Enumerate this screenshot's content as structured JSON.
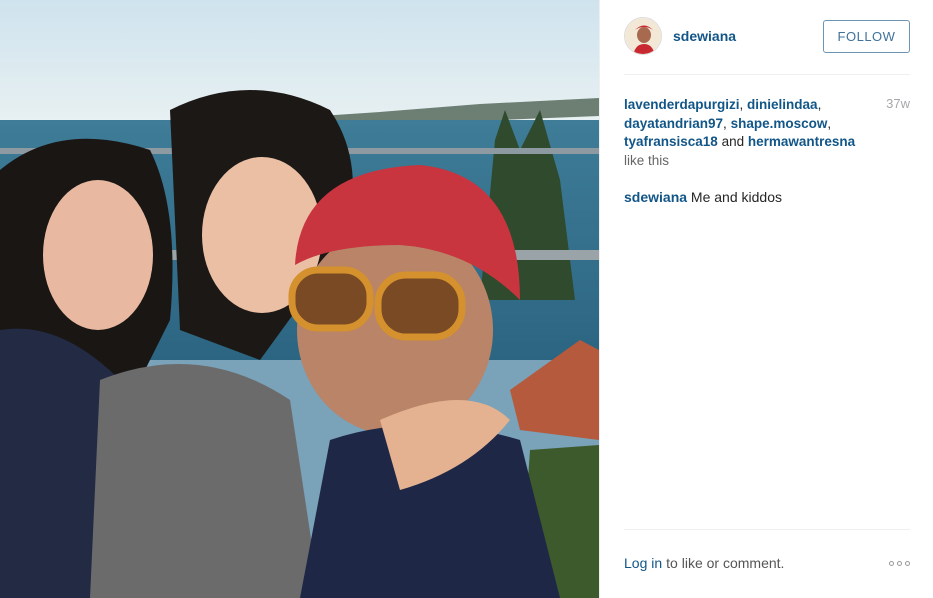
{
  "post": {
    "image_alt": "Selfie of a woman in a red knit beanie and orange sunglasses with two young girls, harbour in background",
    "author": "sdewiana",
    "follow_label": "FOLLOW",
    "timestamp": "37w",
    "likers": [
      "lavenderdapurgizi",
      "dinielindaa",
      "dayatandrian97",
      "shape.moscow",
      "tyafransisca18",
      "hermawantresna"
    ],
    "separator": ", ",
    "and_word": " and ",
    "like_this": "like this",
    "caption": {
      "author": "sdewiana",
      "text": "Me and kiddos"
    }
  },
  "footer": {
    "login_label": "Log in",
    "rest_label": "to like or comment."
  },
  "icons": {
    "more": "more-options-icon"
  },
  "colors": {
    "link": "#125688",
    "follow_border": "#6d94b3",
    "follow_text": "#3f729b",
    "timestamp": "#a5a7aa"
  }
}
